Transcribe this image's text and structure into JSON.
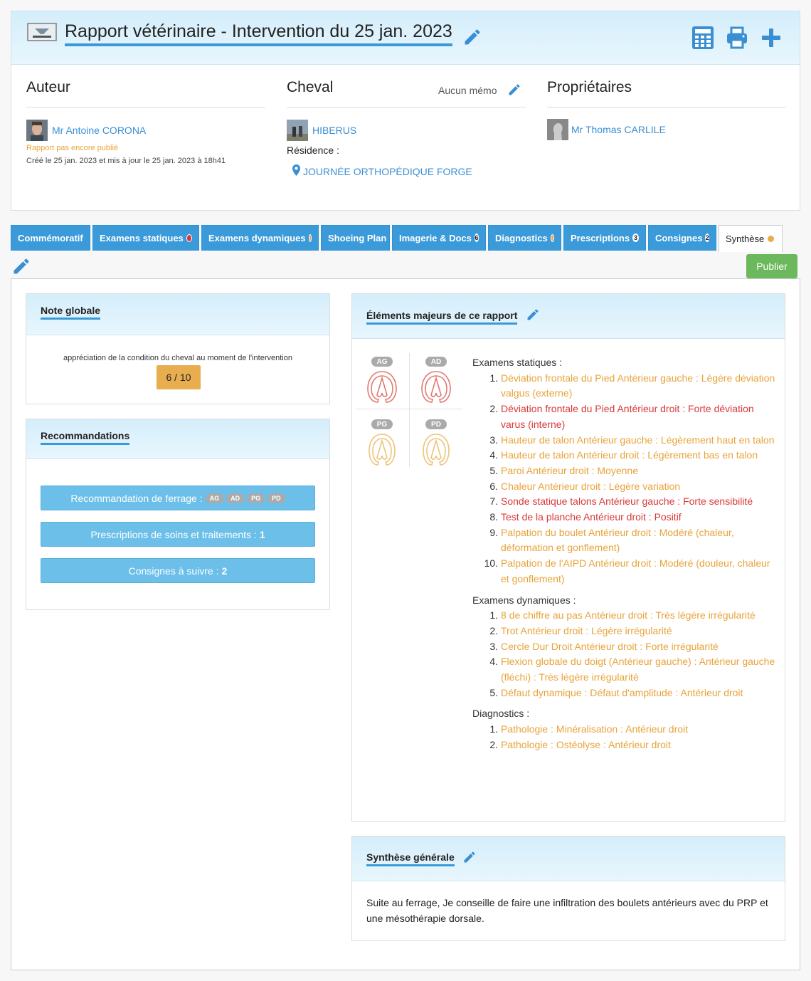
{
  "header": {
    "title": "Rapport vétérinaire - Intervention du 25 jan. 2023"
  },
  "auteur": {
    "heading": "Auteur",
    "name": "Mr Antoine CORONA",
    "status": "Rapport pas encore publié",
    "dates": "Créé le 25 jan. 2023 et mis à jour le 25 jan. 2023 à 18h41"
  },
  "cheval": {
    "heading": "Cheval",
    "memo": "Aucun mémo",
    "name": "HIBERUS",
    "residence_label": "Résidence :",
    "residence": "JOURNÉE ORTHOPÉDIQUE FORGE"
  },
  "proprietaires": {
    "heading": "Propriétaires",
    "name": "Mr Thomas CARLILE"
  },
  "tabs": [
    {
      "label": "Commémoratif"
    },
    {
      "label": "Examens statiques",
      "dot": "#d9383a"
    },
    {
      "label": "Examens dynamiques",
      "dot": "#e8ad4f"
    },
    {
      "label": "Shoeing Plan"
    },
    {
      "label": "Imagerie & Docs",
      "badge": "6"
    },
    {
      "label": "Diagnostics",
      "dot": "#e8ad4f"
    },
    {
      "label": "Prescriptions",
      "badge": "3"
    },
    {
      "label": "Consignes",
      "badge": "2"
    },
    {
      "label": "Synthèse",
      "dot": "#e8ad4f",
      "active": true
    }
  ],
  "publish_label": "Publier",
  "note_globale": {
    "title": "Note globale",
    "desc": "appréciation de la condition du cheval au moment de l'intervention",
    "score": "6 / 10"
  },
  "recommandations": {
    "title": "Recommandations",
    "ferrage_label": "Recommandation de ferrage :",
    "ferrage_chips": [
      "AG",
      "AD",
      "PG",
      "PD"
    ],
    "prescriptions_label": "Prescriptions de soins et traitements :",
    "prescriptions_count": "1",
    "consignes_label": "Consignes à suivre :",
    "consignes_count": "2"
  },
  "elements": {
    "title": "Éléments majeurs de ce rapport",
    "hooves": [
      {
        "label": "AG",
        "color": "#e07a72"
      },
      {
        "label": "AD",
        "color": "#e07a72"
      },
      {
        "label": "PG",
        "color": "#edc47a"
      },
      {
        "label": "PD",
        "color": "#edc47a"
      }
    ],
    "sections": [
      {
        "title": "Examens statiques :",
        "items": [
          {
            "text": "Déviation frontale du Pied Antérieur gauche : Légère déviation valgus (externe)",
            "severity": "orange"
          },
          {
            "text": "Déviation frontale du Pied Antérieur droit : Forte déviation varus (interne)",
            "severity": "red"
          },
          {
            "text": "Hauteur de talon Antérieur gauche : Légèrement haut en talon",
            "severity": "orange"
          },
          {
            "text": "Hauteur de talon Antérieur droit : Légèrement bas en talon",
            "severity": "orange"
          },
          {
            "text": "Paroi Antérieur droit : Moyenne",
            "severity": "orange"
          },
          {
            "text": "Chaleur Antérieur droit : Légère variation",
            "severity": "orange"
          },
          {
            "text": "Sonde statique talons Antérieur gauche : Forte sensibilité",
            "severity": "red"
          },
          {
            "text": "Test de la planche Antérieur droit : Positif",
            "severity": "red"
          },
          {
            "text": "Palpation du boulet Antérieur droit : Modéré (chaleur, déformation et gonflement)",
            "severity": "orange"
          },
          {
            "text": "Palpation de l'AIPD Antérieur droit : Modéré (douleur, chaleur et gonflement)",
            "severity": "orange"
          }
        ]
      },
      {
        "title": "Examens dynamiques :",
        "items": [
          {
            "text": "8 de chiffre au pas Antérieur droit : Très légère irrégularité",
            "severity": "orange"
          },
          {
            "text": "Trot Antérieur droit : Légère irrégularité",
            "severity": "orange"
          },
          {
            "text": "Cercle Dur Droit Antérieur droit : Forte irrégularité",
            "severity": "orange"
          },
          {
            "text": "Flexion globale du doigt (Antérieur gauche) : Antérieur gauche (fléchi) : Très légère irrégularité",
            "severity": "orange"
          },
          {
            "text": "Défaut dynamique : Défaut d'amplitude : Antérieur droit",
            "severity": "orange"
          }
        ]
      },
      {
        "title": "Diagnostics :",
        "items": [
          {
            "text": "Pathologie : Minéralisation : Antérieur droit",
            "severity": "orange"
          },
          {
            "text": "Pathologie : Ostéolyse : Antérieur droit",
            "severity": "orange"
          }
        ]
      }
    ]
  },
  "synthese": {
    "title": "Synthèse générale",
    "text": "Suite au ferrage, Je conseille de faire une infiltration des boulets antérieurs avec du PRP et une mésothérapie dorsale."
  },
  "colors": {
    "accent": "#3b9ad9",
    "orange": "#e8a33a",
    "red": "#d9383a",
    "green": "#6cb85c"
  }
}
